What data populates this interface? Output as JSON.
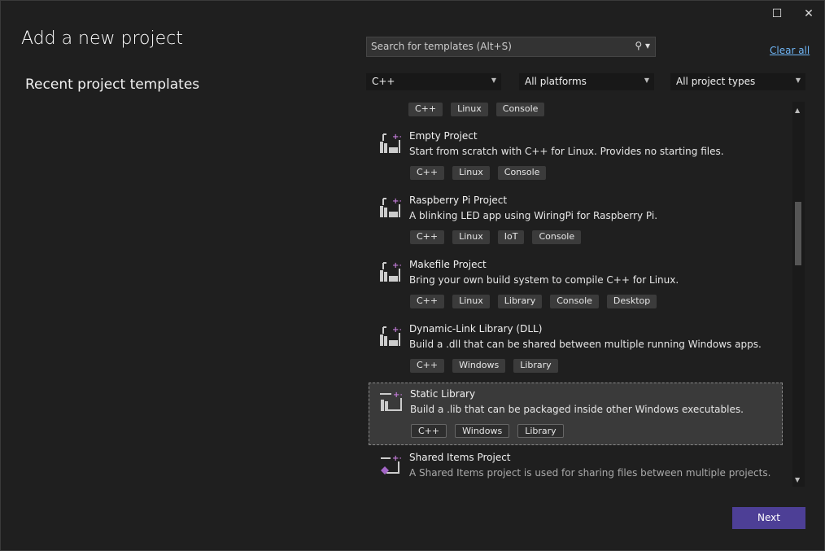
{
  "title": "Add a new project",
  "recent_heading": "Recent project templates",
  "search": {
    "placeholder": "Search for templates (Alt+S)"
  },
  "clear_all": "Clear all",
  "filters": {
    "language": "C++",
    "platform": "All platforms",
    "project_type": "All project types"
  },
  "partial_tags": [
    "C++",
    "Linux",
    "Console"
  ],
  "templates": [
    {
      "name": "Empty Project",
      "description": "Start from scratch with C++ for Linux. Provides no starting files.",
      "tags": [
        "C++",
        "Linux",
        "Console"
      ],
      "icon": "linux-project-icon"
    },
    {
      "name": "Raspberry Pi Project",
      "description": "A blinking LED app using WiringPi for Raspberry Pi.",
      "tags": [
        "C++",
        "Linux",
        "IoT",
        "Console"
      ],
      "icon": "linux-project-icon"
    },
    {
      "name": "Makefile Project",
      "description": "Bring your own build system to compile C++ for Linux.",
      "tags": [
        "C++",
        "Linux",
        "Library",
        "Console",
        "Desktop"
      ],
      "icon": "linux-project-icon"
    },
    {
      "name": "Dynamic-Link Library (DLL)",
      "description": "Build a .dll that can be shared between multiple running Windows apps.",
      "tags": [
        "C++",
        "Windows",
        "Library"
      ],
      "icon": "dll-icon"
    },
    {
      "name": "Static Library",
      "description": "Build a .lib that can be packaged inside other Windows executables.",
      "tags": [
        "C++",
        "Windows",
        "Library"
      ],
      "icon": "static-library-icon",
      "selected": true
    },
    {
      "name": "Shared Items Project",
      "description": "A Shared Items project is used for sharing files between multiple projects.",
      "tags": [],
      "icon": "shared-items-icon"
    }
  ],
  "next": "Next",
  "accent": "#4d3f96"
}
